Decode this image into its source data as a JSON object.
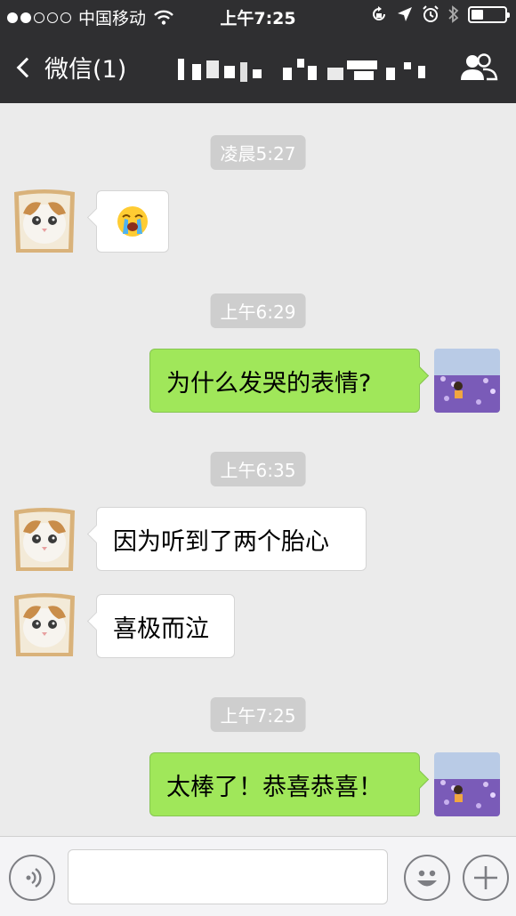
{
  "status_bar": {
    "carrier": "中国移动",
    "time": "上午7:25",
    "signal_strength": 2,
    "signal_max": 5,
    "battery_level": 0.35,
    "icons": [
      "wifi-icon",
      "orientation-lock-icon",
      "location-icon",
      "alarm-icon",
      "bluetooth-icon",
      "battery-icon"
    ]
  },
  "nav": {
    "back_label": "微信(1)",
    "title_redacted": true,
    "right_icon": "contact-icon"
  },
  "chat": {
    "timestamps": [
      "凌晨5:27",
      "上午6:29",
      "上午6:35",
      "上午7:25"
    ],
    "messages": [
      {
        "side": "in",
        "type": "emoji",
        "text": "😭",
        "emoji_name": "loudly-crying-face"
      },
      {
        "side": "out",
        "type": "text",
        "text": "为什么发哭的表情?"
      },
      {
        "side": "in",
        "type": "text",
        "text": "因为听到了两个胎心"
      },
      {
        "side": "in",
        "type": "text",
        "text": "喜极而泣"
      },
      {
        "side": "out",
        "type": "text",
        "text": "太棒了！恭喜恭喜！"
      }
    ],
    "bubble_colors": {
      "incoming": "#ffffff",
      "outgoing": "#a0e75a"
    }
  },
  "input_bar": {
    "text_value": "",
    "left_icon": "voice-icon",
    "emoji_icon": "emoji-icon",
    "add_icon": "add-icon"
  },
  "colors": {
    "nav_background": "#2f2f31",
    "chat_background": "#ebebeb",
    "time_pill": "#cecece"
  }
}
